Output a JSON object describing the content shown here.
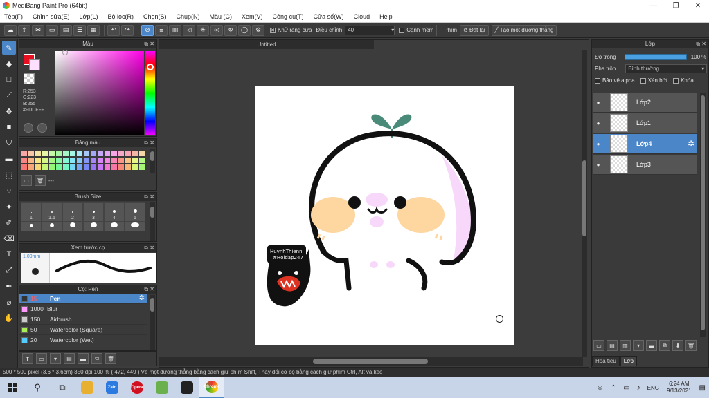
{
  "window": {
    "title": "MediBang Paint Pro (64bit)",
    "minimize": "—",
    "maximize": "❐",
    "close": "✕"
  },
  "menu": [
    "Tệp(F)",
    "Chỉnh sửa(E)",
    "Lớp(L)",
    "Bộ lọc(R)",
    "Chọn(S)",
    "Chụp(N)",
    "Màu (C)",
    "Xem(V)",
    "Công cụ(T)",
    "Cửa số(W)",
    "Cloud",
    "Help"
  ],
  "toolbar": {
    "antialias_label": "Khử răng cưa",
    "correction_label": "Điều chỉnh",
    "correction_value": "40",
    "canh_mem_label": "Cạnh mềm",
    "phim_label": "Phím",
    "reset_label": "Đặt lại",
    "straight_line_label": "Tạo một đường thẳng"
  },
  "color_panel": {
    "title": "Màu",
    "r": "R:253",
    "g": "G:223",
    "b": "B:255",
    "hex": "#FDDFFF",
    "fg_color": "#e81020",
    "bg_color": "#fddfff"
  },
  "palette_panel": {
    "title": "Bảng màu",
    "label": "---",
    "colors": [
      "#f6a6a6",
      "#f6c6a6",
      "#f6e6a6",
      "#e6f6a6",
      "#c6f6a6",
      "#a6f6a6",
      "#a6f6c6",
      "#a6f6e6",
      "#a6e6f6",
      "#a6c6f6",
      "#a6a6f6",
      "#c6a6f6",
      "#e6a6f6",
      "#f6a6e6",
      "#f6a6c6",
      "#f6a6b6",
      "#f6b6a6",
      "#f6d6a6",
      "#f68686",
      "#f6b686",
      "#f6e686",
      "#d6f686",
      "#a6f686",
      "#86f6a6",
      "#86f6d6",
      "#86e6f6",
      "#86c6f6",
      "#8696f6",
      "#a686f6",
      "#d686f6",
      "#f686e6",
      "#f686b6",
      "#f69686",
      "#f6c686",
      "#e6f686",
      "#b6f686",
      "#f67676",
      "#f6a676",
      "#f6d676",
      "#c6f676",
      "#96f676",
      "#76f696",
      "#76f6c6",
      "#76d6f6",
      "#76a6f6",
      "#7686f6",
      "#9676f6",
      "#c676f6",
      "#f676d6",
      "#f676a6",
      "#f68676",
      "#f6b676",
      "#d6f676",
      "#a6f676"
    ]
  },
  "brush_size_panel": {
    "title": "Brush Size",
    "sizes": [
      "1",
      "1.5",
      "2",
      "3",
      "4",
      "5"
    ]
  },
  "preview_panel": {
    "title": "Xem trước cọ",
    "size": "1.09mm"
  },
  "brush_panel": {
    "title": "Cọ: Pen",
    "items": [
      {
        "size": "15",
        "name": "Pen",
        "color": "#333333",
        "active": true
      },
      {
        "size": "1000",
        "name": "Blur",
        "color": "#ff99ff",
        "active": false
      },
      {
        "size": "150",
        "name": "Airbrush",
        "color": "#cccccc",
        "active": false
      },
      {
        "size": "50",
        "name": "Watercolor (Square)",
        "color": "#aaee55",
        "active": false
      },
      {
        "size": "20",
        "name": "Watercolor (Wet)",
        "color": "#55ccff",
        "active": false
      }
    ]
  },
  "canvas": {
    "tab_title": "Untitled",
    "watermark_line1": "HuynhThienn",
    "watermark_line2": "#Hoidap247",
    "colors": {
      "outline": "#111111",
      "blush": "#fdd6a0",
      "pink": "#f8d8fa",
      "leaf": "#4a8a78"
    }
  },
  "layer_panel": {
    "title": "Lớp",
    "opacity_label": "Độ trong",
    "opacity_value": "100 %",
    "opacity_fraction": 1.0,
    "blend_label": "Pha trộn",
    "blend_value": "Bình thường",
    "protect_alpha": "Bảo vệ alpha",
    "clipping": "Xén bớt",
    "lock": "Khóa",
    "layers": [
      {
        "name": "Lớp2",
        "active": false
      },
      {
        "name": "Lớp1",
        "active": false
      },
      {
        "name": "Lớp4",
        "active": true
      },
      {
        "name": "Lớp3",
        "active": false
      }
    ],
    "tabs": [
      "Hoa tiêu",
      "Lớp"
    ]
  },
  "status": {
    "text": "500 * 500 pixel   (3.6 * 3.6cm)   350 dpi   100 %   ( 472, 449 )   Vẽ một đường thẳng bằng cách giữ phím Shift, Thay đổi cỡ cọ bằng cách giữ phím Ctrl, Alt và kéo"
  },
  "taskbar": {
    "lang": "ENG",
    "time": "6:24 AM",
    "date": "9/13/2021",
    "apps": [
      "Zalo",
      "Opera",
      "Chrome"
    ]
  }
}
